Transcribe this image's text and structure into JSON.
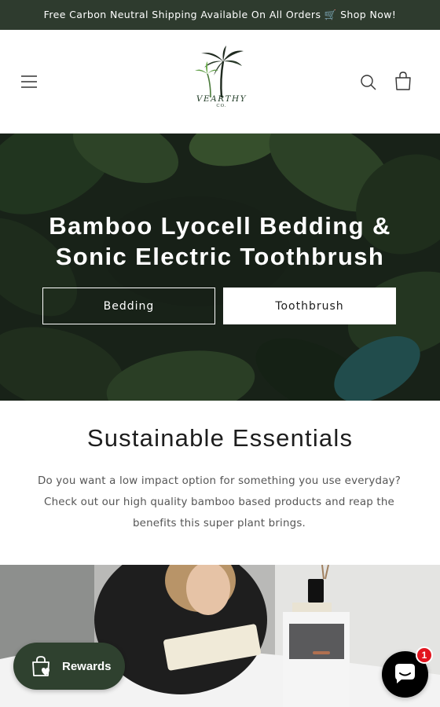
{
  "announcement": {
    "text": "Free Carbon Neutral Shipping Available On All Orders 🛒 Shop Now!"
  },
  "header": {
    "logo_text": "VEARTHY",
    "logo_subtext": "CO.",
    "icons": [
      "menu-icon",
      "search-icon",
      "cart-icon"
    ]
  },
  "hero": {
    "title_line1": "Bamboo Lyocell Bedding &",
    "title_line2": "Sonic Electric Toothbrush",
    "buttons": [
      {
        "label": "Bedding",
        "style": "outline"
      },
      {
        "label": "Toothbrush",
        "style": "solid"
      }
    ]
  },
  "rich_text": {
    "heading": "Sustainable Essentials",
    "body": "Do you want a low impact option for something you use everyday? Check out our high quality bamboo based products and reap the benefits this super plant brings."
  },
  "widgets": {
    "rewards_label": "Rewards",
    "chat_badge_count": "1",
    "icons": [
      "rewards-bag-icon",
      "chat-icon"
    ]
  },
  "colors": {
    "announcement_bg": "#2e3b2e",
    "rewards_bg": "#2f412f",
    "badge": "#e2151f"
  }
}
